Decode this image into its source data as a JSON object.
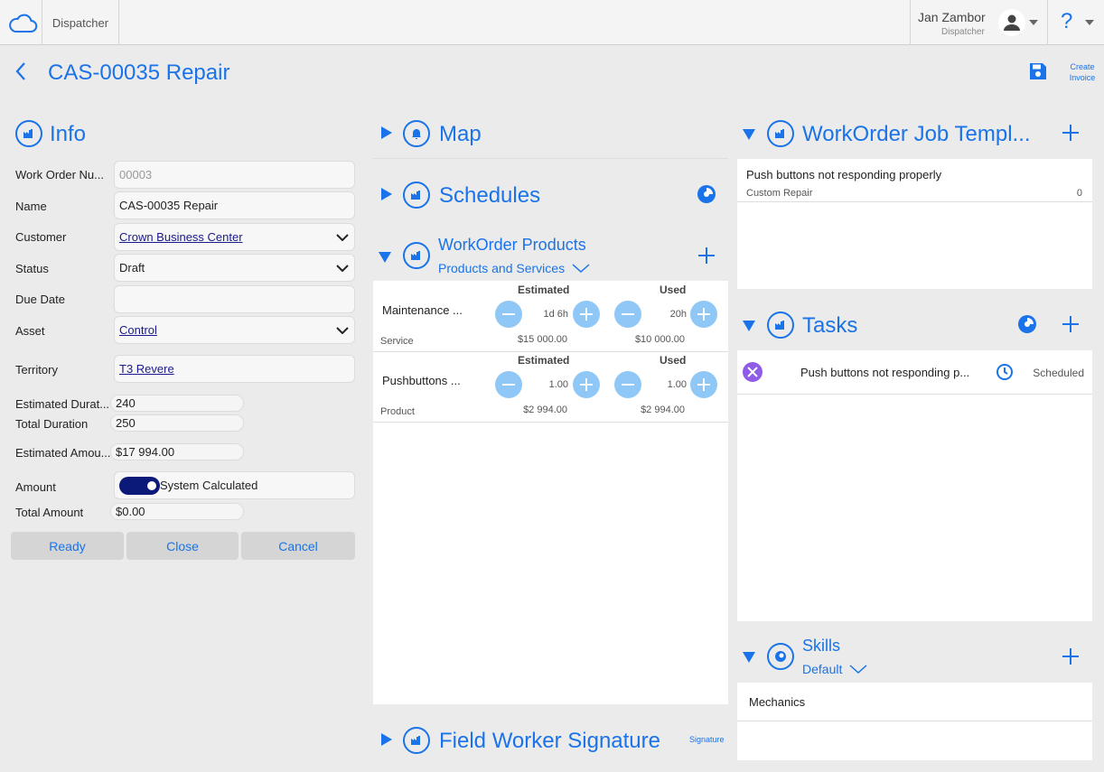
{
  "topbar": {
    "app_name": "Dispatcher",
    "user_name": "Jan Zambor",
    "user_role": "Dispatcher",
    "help_label": "?"
  },
  "header": {
    "title": "CAS-00035 Repair",
    "create_invoice_line1": "Create",
    "create_invoice_line2": "Invoice"
  },
  "info": {
    "title": "Info",
    "fields": {
      "work_order_number": {
        "label": "Work Order Nu...",
        "value": "00003"
      },
      "name": {
        "label": "Name",
        "value": "CAS-00035 Repair"
      },
      "customer": {
        "label": "Customer",
        "value": "Crown Business Center"
      },
      "status": {
        "label": "Status",
        "value": "Draft"
      },
      "due_date": {
        "label": "Due Date",
        "value": ""
      },
      "asset": {
        "label": "Asset",
        "value": "Control"
      },
      "territory": {
        "label": "Territory",
        "value": "T3 Revere"
      },
      "estimated_duration": {
        "label": "Estimated Durat...",
        "value": "240"
      },
      "total_duration": {
        "label": "Total Duration",
        "value": "250"
      },
      "estimated_amount": {
        "label": "Estimated Amou...",
        "value": "$17 994.00"
      },
      "amount": {
        "label": "Amount",
        "toggle_label": "System Calculated"
      },
      "total_amount": {
        "label": "Total Amount",
        "value": "$0.00"
      }
    },
    "buttons": {
      "ready": "Ready",
      "close": "Close",
      "cancel": "Cancel"
    }
  },
  "map": {
    "title": "Map"
  },
  "schedules": {
    "title": "Schedules"
  },
  "products": {
    "title": "WorkOrder Products",
    "filter": "Products and Services",
    "items": [
      {
        "name": "Maintenance ...",
        "type": "Service",
        "estimated_label": "Estimated",
        "used_label": "Used",
        "estimated": "1d 6h",
        "used": "20h",
        "estimated_price": "$15 000.00",
        "used_price": "$10 000.00"
      },
      {
        "name": "Pushbuttons ...",
        "type": "Product",
        "estimated_label": "Estimated",
        "used_label": "Used",
        "estimated": "1.00",
        "used": "1.00",
        "estimated_price": "$2 994.00",
        "used_price": "$2 994.00"
      }
    ]
  },
  "signature": {
    "title": "Field Worker Signature",
    "action": "Signature"
  },
  "job_templates": {
    "title": "WorkOrder Job Templ...",
    "items": [
      {
        "name": "Push buttons not responding properly",
        "sub": "Custom Repair",
        "count": "0"
      }
    ]
  },
  "tasks": {
    "title": "Tasks",
    "items": [
      {
        "name": "Push buttons not responding p...",
        "status": "Scheduled"
      }
    ]
  },
  "skills": {
    "title": "Skills",
    "filter": "Default",
    "items": [
      {
        "name": "Mechanics"
      }
    ]
  },
  "colors": {
    "accent": "#1a73e8",
    "link": "#1a1a8c",
    "toggle": "#0b1a78",
    "task_icon": "#8e5ce6",
    "stepper": "#8fc8f6"
  }
}
